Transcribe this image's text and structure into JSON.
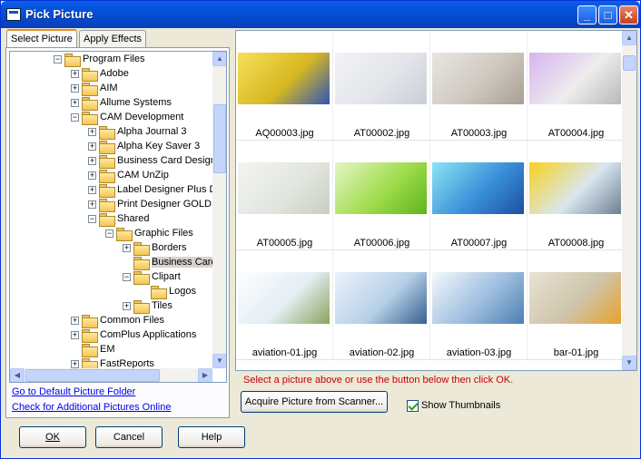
{
  "window": {
    "title": "Pick Picture"
  },
  "tabs": [
    {
      "label": "Select Picture",
      "active": true
    },
    {
      "label": "Apply Effects",
      "active": false
    }
  ],
  "tree": [
    {
      "label": "Program Files",
      "depth": 2,
      "expander": "−"
    },
    {
      "label": "Adobe",
      "depth": 3,
      "expander": "+"
    },
    {
      "label": "AIM",
      "depth": 3,
      "expander": "+"
    },
    {
      "label": "Allume Systems",
      "depth": 3,
      "expander": "+"
    },
    {
      "label": "CAM Development",
      "depth": 3,
      "expander": "−"
    },
    {
      "label": "Alpha Journal 3",
      "depth": 4,
      "expander": "+"
    },
    {
      "label": "Alpha Key Saver 3",
      "depth": 4,
      "expander": "+"
    },
    {
      "label": "Business Card Design",
      "depth": 4,
      "expander": "+"
    },
    {
      "label": "CAM UnZip",
      "depth": 4,
      "expander": "+"
    },
    {
      "label": "Label Designer Plus D",
      "depth": 4,
      "expander": "+"
    },
    {
      "label": "Print Designer GOLD",
      "depth": 4,
      "expander": "+"
    },
    {
      "label": "Shared",
      "depth": 4,
      "expander": "−"
    },
    {
      "label": "Graphic Files",
      "depth": 5,
      "expander": "−"
    },
    {
      "label": "Borders",
      "depth": 6,
      "expander": "+"
    },
    {
      "label": "Business Card",
      "depth": 6,
      "expander": "",
      "selected": true
    },
    {
      "label": "Clipart",
      "depth": 6,
      "expander": "−"
    },
    {
      "label": "Logos",
      "depth": 7,
      "expander": ""
    },
    {
      "label": "Tiles",
      "depth": 6,
      "expander": "+"
    },
    {
      "label": "Common Files",
      "depth": 3,
      "expander": "+"
    },
    {
      "label": "ComPlus Applications",
      "depth": 3,
      "expander": "+"
    },
    {
      "label": "EM",
      "depth": 3,
      "expander": ""
    },
    {
      "label": "FastReports",
      "depth": 3,
      "expander": "+"
    }
  ],
  "links": {
    "default_folder": "Go to Default Picture Folder",
    "online": "Check for Additional Pictures Online"
  },
  "thumbnails": [
    {
      "name": "AQ00003.jpg",
      "c1": "#F5E05A",
      "c2": "#D8B820",
      "c3": "#2E55B8"
    },
    {
      "name": "AT00002.jpg",
      "c1": "#F2F3F6",
      "c2": "#E3E5EA",
      "c3": "#CACED6"
    },
    {
      "name": "AT00003.jpg",
      "c1": "#E8E6E2",
      "c2": "#CFC8BF",
      "c3": "#A89E92"
    },
    {
      "name": "AT00004.jpg",
      "c1": "#D8B2F0",
      "c2": "#EDEDED",
      "c3": "#B8B8B8"
    },
    {
      "name": "AT00005.jpg",
      "c1": "#F3F4F2",
      "c2": "#E2E6DF",
      "c3": "#C9CFC4"
    },
    {
      "name": "AT00006.jpg",
      "c1": "#E4F6C8",
      "c2": "#9FDC4A",
      "c3": "#5EB51E"
    },
    {
      "name": "AT00007.jpg",
      "c1": "#8BE6F6",
      "c2": "#3A8FD8",
      "c3": "#1C4FA2"
    },
    {
      "name": "AT00008.jpg",
      "c1": "#F7D21C",
      "c2": "#D9E6EF",
      "c3": "#6D7F91"
    },
    {
      "name": "aviation-01.jpg",
      "c1": "#FDFEFF",
      "c2": "#E3EDF3",
      "c3": "#8AA45C"
    },
    {
      "name": "aviation-02.jpg",
      "c1": "#EAF2FA",
      "c2": "#B6D0E8",
      "c3": "#36608E"
    },
    {
      "name": "aviation-03.jpg",
      "c1": "#F4F8FC",
      "c2": "#9DBEDE",
      "c3": "#4B7FB3"
    },
    {
      "name": "bar-01.jpg",
      "c1": "#E8E2D4",
      "c2": "#CFC4AA",
      "c3": "#E6A22C"
    }
  ],
  "hint": "Select a picture above or use  the button below then click OK.",
  "buttons": {
    "acquire": "Acquire Picture from Scanner...",
    "show_thumbnails": "Show Thumbnails",
    "ok": "OK",
    "cancel": "Cancel",
    "help": "Help"
  }
}
